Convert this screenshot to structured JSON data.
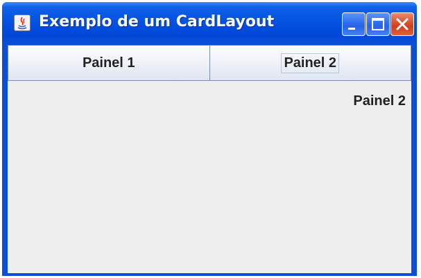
{
  "window": {
    "title": "Exemplo de um CardLayout"
  },
  "buttons": [
    {
      "label": "Painel 1"
    },
    {
      "label": "Painel 2"
    }
  ],
  "panel": {
    "label": "Painel 2"
  },
  "colors": {
    "titlebar": "#0551e0",
    "content_bg": "#eeeeee",
    "close_button": "#d9502d"
  },
  "icons": [
    "java-icon",
    "minimize-icon",
    "maximize-icon",
    "close-icon"
  ]
}
